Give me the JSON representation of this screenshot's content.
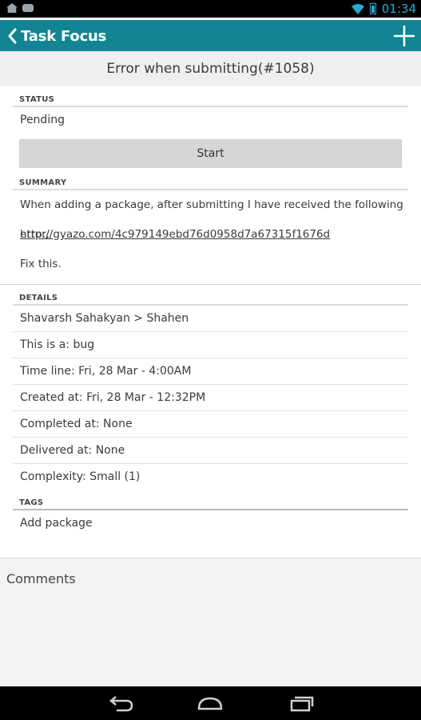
{
  "status_bar": {
    "time": "01:34"
  },
  "app_bar": {
    "title": "Task Focus"
  },
  "page_title": "Error when submitting(#1058)",
  "status_section": {
    "label": "STATUS",
    "value": "Pending",
    "button_label": "Start"
  },
  "summary_section": {
    "label": "SUMMARY",
    "line1": "When adding a package, after submitting I have received the following error,",
    "link": "http://gyazo.com/4c979149ebd76d0958d7a67315f1676d",
    "line3": "Fix this."
  },
  "details_section": {
    "label": "DETAILS",
    "rows": [
      "Shavarsh Sahakyan > Shahen",
      "This is a: bug",
      "Time line: Fri, 28 Mar - 4:00AM",
      "Created at: Fri, 28 Mar - 12:32PM",
      "Completed at: None",
      "Delivered at: None",
      "Complexity: Small (1)"
    ]
  },
  "tags_section": {
    "label": "TAGS",
    "add_label": "Add package"
  },
  "comments": {
    "label": "Comments"
  },
  "icons": {
    "back": "chevron-left-icon",
    "add": "plus-icon",
    "nav_back": "back-arrow-icon",
    "nav_home": "home-icon",
    "nav_recents": "recents-icon"
  },
  "colors": {
    "app_bar": "#138592",
    "status_accent": "#2aa9d6",
    "button_bg": "#d6d6d6",
    "page_header_bg": "#efefef"
  }
}
